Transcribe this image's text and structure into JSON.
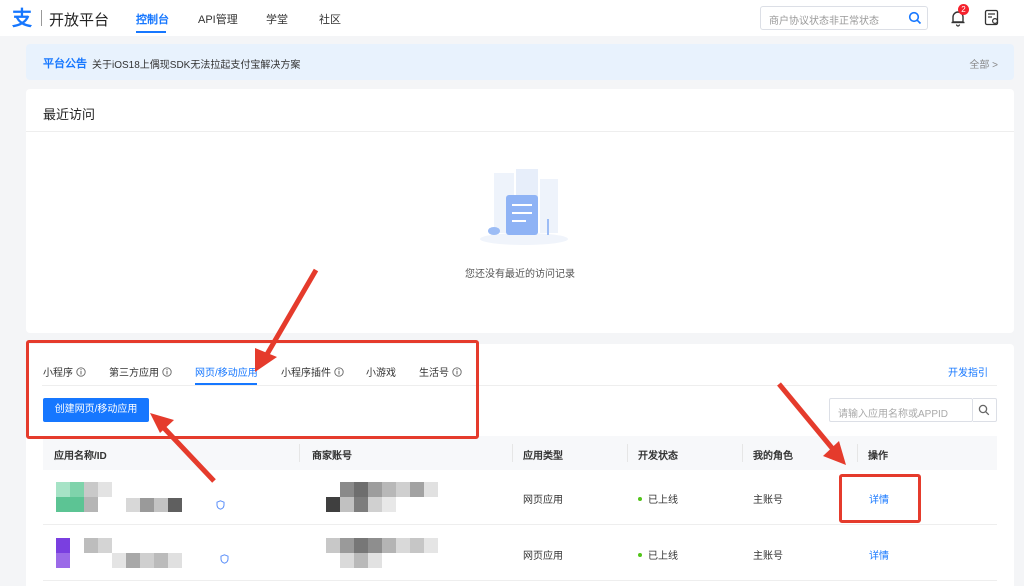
{
  "topnav": {
    "logo_mark": "支",
    "brand": "开放平台",
    "items": [
      {
        "label": "控制台",
        "active": true
      },
      {
        "label": "API管理",
        "active": false
      },
      {
        "label": "学堂",
        "active": false
      },
      {
        "label": "社区",
        "active": false
      }
    ],
    "search_placeholder": "商户协议状态非正常状态",
    "notification_count": "2"
  },
  "notice": {
    "tag": "平台公告",
    "text": "关于iOS18上偶现SDK无法拉起支付宝解决方案",
    "more": "全部 >"
  },
  "recent": {
    "title": "最近访问",
    "empty_text": "您还没有最近的访问记录"
  },
  "apps": {
    "tabs": [
      {
        "label": "小程序",
        "info": true,
        "active": false
      },
      {
        "label": "第三方应用",
        "info": true,
        "active": false
      },
      {
        "label": "网页/移动应用",
        "info": false,
        "active": true
      },
      {
        "label": "小程序插件",
        "info": true,
        "active": false
      },
      {
        "label": "小游戏",
        "info": false,
        "active": false
      },
      {
        "label": "生活号",
        "info": true,
        "active": false
      }
    ],
    "guide_link": "开发指引",
    "create_button": "创建网页/移动应用",
    "search_placeholder": "请输入应用名称或APPID",
    "columns": [
      "应用名称/ID",
      "商家账号",
      "应用类型",
      "开发状态",
      "我的角色",
      "操作"
    ],
    "rows": [
      {
        "type": "网页应用",
        "status": "已上线",
        "role": "主账号",
        "action": "详情"
      },
      {
        "type": "网页应用",
        "status": "已上线",
        "role": "主账号",
        "action": "详情"
      }
    ]
  },
  "colors": {
    "accent": "#1677ff",
    "annotation": "#e53b2c",
    "status_online": "#52c41a"
  }
}
